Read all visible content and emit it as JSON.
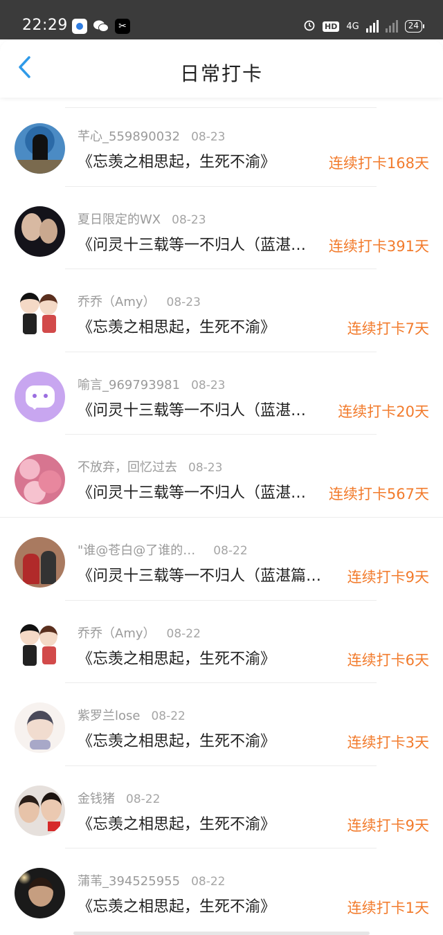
{
  "status_bar": {
    "time": "22:29",
    "network": "4G",
    "hd": "HD",
    "battery": "24"
  },
  "header": {
    "title": "日常打卡"
  },
  "checkins": [
    {
      "name": "芊心_559890032",
      "date": "08-23",
      "content": "《忘羡之相思起，生死不渝》",
      "streak": "连续打卡168天",
      "avatar": "elder-photo"
    },
    {
      "name": "夏日限定的WX",
      "date": "08-23",
      "content": "《问灵十三载等一不归人（蓝湛…",
      "streak": "连续打卡391天",
      "avatar": "two-men-photo"
    },
    {
      "name": "乔乔（Amy）",
      "date": "08-23",
      "content": "《忘羡之相思起，生死不渝》",
      "streak": "连续打卡7天",
      "avatar": "cartoon-couple"
    },
    {
      "name": "喻言_969793981",
      "date": "08-23",
      "content": "《问灵十三载等一不归人（蓝湛…",
      "streak": "连续打卡20天",
      "avatar": "default-chat-bubble"
    },
    {
      "name": "不放弃，回忆过去",
      "date": "08-23",
      "content": "《问灵十三载等一不归人（蓝湛…",
      "streak": "连续打卡567天",
      "avatar": "pink-blossoms"
    },
    {
      "name": "\"谁@苍白@了谁的…",
      "date": "08-22",
      "content": "《问灵十三载等一不归人（蓝湛篇…",
      "streak": "连续打卡9天",
      "avatar": "two-people-street"
    },
    {
      "name": "乔乔（Amy）",
      "date": "08-22",
      "content": "《忘羡之相思起，生死不渝》",
      "streak": "连续打卡6天",
      "avatar": "cartoon-couple"
    },
    {
      "name": "紫罗兰lose",
      "date": "08-22",
      "content": "《忘羡之相思起，生死不渝》",
      "streak": "连续打卡3天",
      "avatar": "anime-character"
    },
    {
      "name": "金钱猪",
      "date": "08-22",
      "content": "《忘羡之相思起，生死不渝》",
      "streak": "连续打卡9天",
      "avatar": "two-women-selfie"
    },
    {
      "name": "蒲苇_394525955",
      "date": "08-22",
      "content": "《忘羡之相思起，生死不渝》",
      "streak": "连续打卡1天",
      "avatar": "woman-night-photo"
    }
  ],
  "colors": {
    "accent": "#f27b2c",
    "back_icon": "#2f9ae8",
    "status_bar_bg": "#3b3b3b"
  },
  "icons": {
    "back": "chevron-left-icon",
    "alarm": "alarm-icon",
    "signal": "signal-icon",
    "battery": "battery-icon"
  }
}
